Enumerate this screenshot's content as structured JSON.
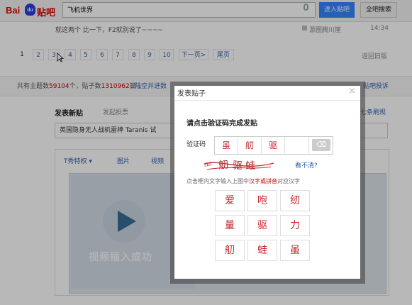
{
  "header": {
    "logo_bai": "Bai",
    "logo_du": "du",
    "logo_tieba": "贴吧",
    "search_value": "飞机世界",
    "enter_button": "进入贴吧",
    "search_all_button": "全吧搜索"
  },
  "post": {
    "text": "就这两个 比一下，F2就别说了~~~~",
    "author": "源图腾川崖",
    "time": "14:34"
  },
  "pagination": {
    "pages": [
      "1",
      "2",
      "3",
      "4",
      "5",
      "6",
      "7",
      "8",
      "9",
      "10"
    ],
    "current": "1",
    "next": "下一页>",
    "last": "尾页",
    "back_old": "返回旧版"
  },
  "stats": {
    "prefix": "共有主题数",
    "topics": "59104",
    "mid": "个，贴子数",
    "posts": "1310962",
    "suffix": "篇 ，",
    "link": "陆空并进数",
    "report": "贴吧投诉"
  },
  "editor": {
    "new_post": "发表新贴",
    "vote_tab": "发起投票",
    "seven_link": "七条刷规",
    "title_value": "英国隐身无人战机雷神 Taranis 试",
    "tool_t": "T秀特权 ▾",
    "tool_pic": "图片",
    "tool_vid": "视频",
    "video_caption": "视频插入成功"
  },
  "modal": {
    "title": "发表贴子",
    "close": "×",
    "instruction": "请点击验证码完成发贴",
    "captcha_label": "验证码",
    "entered": [
      "虽",
      "舠",
      "驱",
      ""
    ],
    "clear_icon": "⌫",
    "captcha_chars": [
      "虽",
      "舠",
      "驱",
      "蛙"
    ],
    "captcha_noise": "sui",
    "unclear": "看不清?",
    "hint_before": "点击框内文字输入上图中",
    "hint_red": "汉字或拼音",
    "hint_after": "对应汉字",
    "grid": [
      "爱",
      "咆",
      "纫",
      "量",
      "驱",
      "力",
      "舠",
      "蛙",
      "虽"
    ]
  },
  "colors": {
    "accent": "#3385ff",
    "link": "#2d64b3",
    "captcha_red": "#c0282c",
    "stat_red": "#cc0000"
  }
}
